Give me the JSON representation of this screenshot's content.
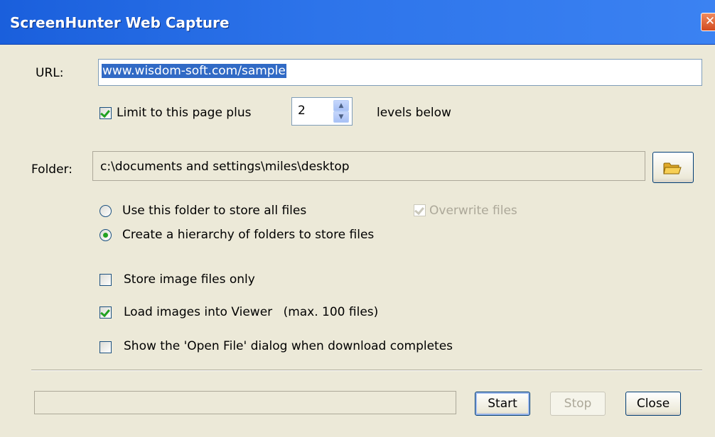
{
  "window": {
    "title": "ScreenHunter Web Capture",
    "close_glyph": "✕"
  },
  "url": {
    "label": "URL:",
    "value": "www.wisdom-soft.com/sample"
  },
  "limit": {
    "checked": true,
    "label": "Limit to this page plus",
    "levels": "2",
    "suffix": "levels below"
  },
  "folder": {
    "label": "Folder:",
    "path": "c:\\documents and settings\\miles\\desktop",
    "browse_icon": "folder-icon"
  },
  "storage": {
    "option_single": "Use this folder to store all files",
    "option_hierarchy": "Create a hierarchy of folders to store files",
    "selected": "option_hierarchy",
    "overwrite_label": "Overwrite files",
    "overwrite_checked": true,
    "overwrite_enabled": false
  },
  "options": {
    "images_only": {
      "label": "Store image files only",
      "checked": false
    },
    "load_viewer": {
      "label": "Load images into Viewer",
      "note": "(max. 100 files)",
      "checked": true
    },
    "open_file": {
      "label": "Show the 'Open File' dialog when download completes",
      "checked": false
    }
  },
  "buttons": {
    "start": "Start",
    "stop": "Stop",
    "close": "Close"
  },
  "progress": {
    "value": 0
  }
}
